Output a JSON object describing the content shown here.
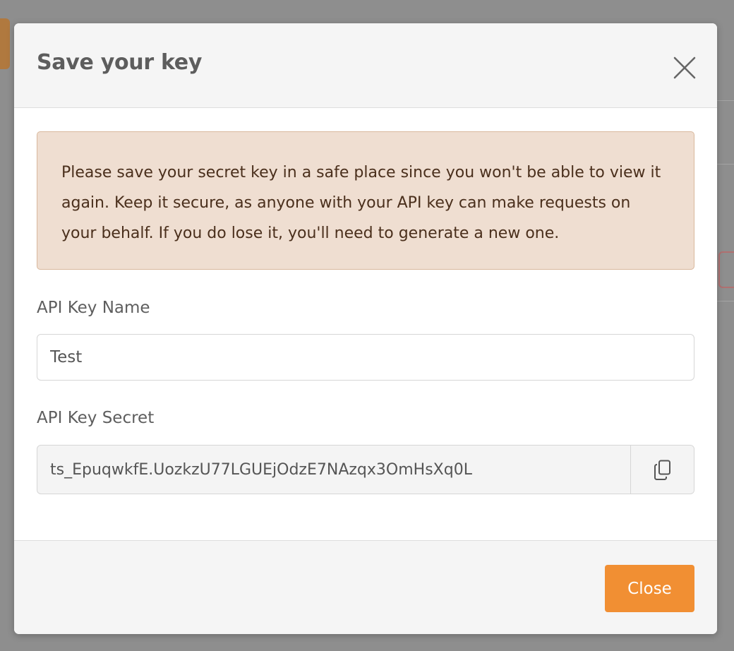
{
  "modal": {
    "title": "Save your key",
    "warning": "Please save your secret key in a safe place since you won't be able to view it again. Keep it secure, as anyone with your API key can make requests on your behalf. If you do lose it, you'll need to generate a new one.",
    "fields": {
      "name_label": "API Key Name",
      "name_value": "Test",
      "secret_label": "API Key Secret",
      "secret_value": "ts_EpuqwkfE.UozkzU77LGUEjOdzE7NAzqx3OmHsXq0L"
    },
    "footer": {
      "close_label": "Close"
    }
  },
  "icons": {
    "dismiss": "close-icon",
    "copy": "copy-icon"
  },
  "colors": {
    "accent": "#f18f33",
    "alert_bg": "#efded1",
    "alert_border": "#d9b89d",
    "alert_text": "#4a2f1c",
    "overlay": "#8e8e8e"
  }
}
